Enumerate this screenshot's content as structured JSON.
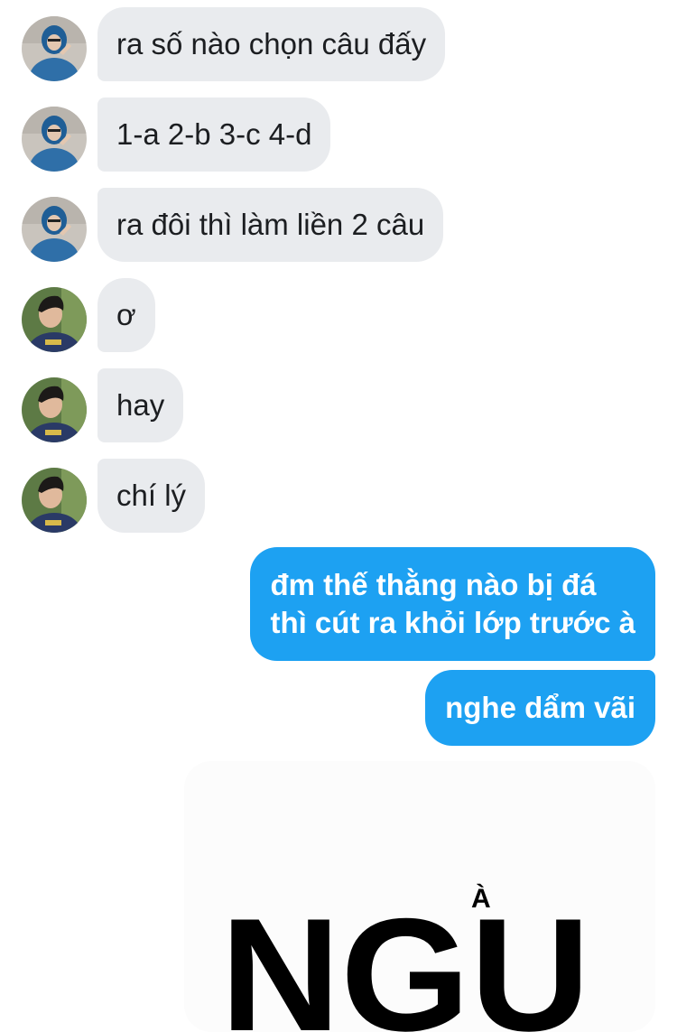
{
  "messages_in": [
    {
      "text": "ra số nào chọn câu đấy",
      "avatar": "friend-blue-hoodie-avatar"
    },
    {
      "text": "1-a 2-b 3-c 4-d",
      "avatar": "friend-blue-hoodie-avatar"
    },
    {
      "text": "ra đôi thì làm liền 2 câu",
      "avatar": "friend-blue-hoodie-avatar"
    },
    {
      "text": "ơ",
      "avatar": "friend-dark-hair-avatar"
    },
    {
      "text": "hay",
      "avatar": "friend-dark-hair-avatar"
    },
    {
      "text": "chí lý",
      "avatar": "friend-dark-hair-avatar"
    }
  ],
  "messages_out": [
    {
      "lines": [
        "đm thế thằng nào bị đá",
        "thì cút ra khỏi lớp trước à"
      ]
    },
    {
      "lines": [
        "nghe dẩm vãi"
      ]
    }
  ],
  "image_message": {
    "main_text": "NGU",
    "accent": "À"
  },
  "colors": {
    "incoming_bubble": "#e9ebee",
    "outgoing_bubble": "#1da1f2",
    "incoming_text": "#1c1e21",
    "outgoing_text": "#ffffff"
  }
}
